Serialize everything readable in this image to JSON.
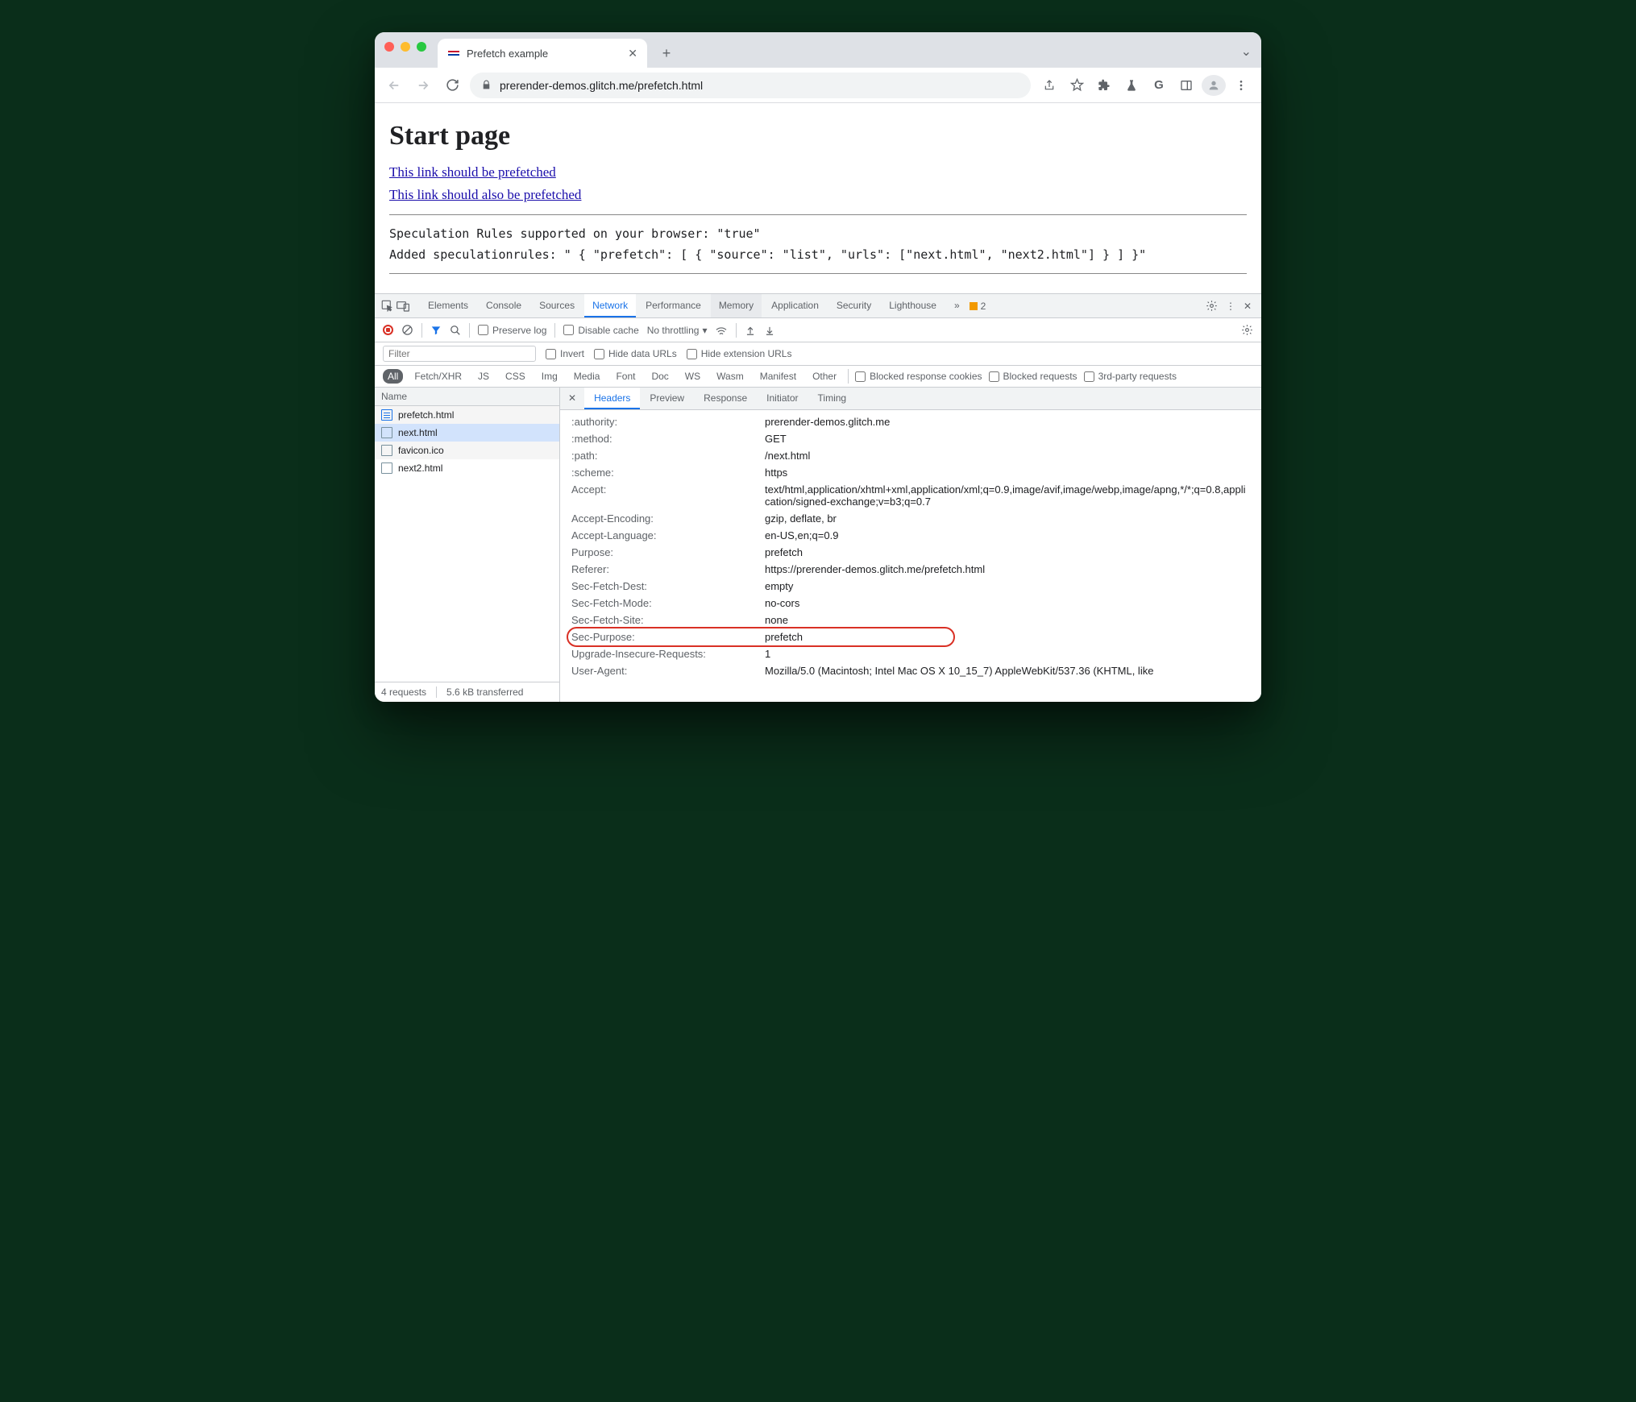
{
  "browser": {
    "tab_title": "Prefetch example",
    "url": "prerender-demos.glitch.me/prefetch.html"
  },
  "page": {
    "heading": "Start page",
    "link1": "This link should be prefetched",
    "link2": "This link should also be prefetched",
    "status1": "Speculation Rules supported on your browser: \"true\"",
    "status2": "Added speculationrules: \" { \"prefetch\": [ { \"source\": \"list\", \"urls\": [\"next.html\", \"next2.html\"] } ] }\""
  },
  "devtools": {
    "panels": {
      "elements": "Elements",
      "console": "Console",
      "sources": "Sources",
      "network": "Network",
      "performance": "Performance",
      "memory": "Memory",
      "application": "Application",
      "security": "Security",
      "lighthouse": "Lighthouse"
    },
    "issues_count": "2",
    "toolbar": {
      "preserve": "Preserve log",
      "disable_cache": "Disable cache",
      "throttling": "No throttling"
    },
    "filter": {
      "placeholder": "Filter",
      "invert": "Invert",
      "hide_data": "Hide data URLs",
      "hide_ext": "Hide extension URLs"
    },
    "types": [
      "All",
      "Fetch/XHR",
      "JS",
      "CSS",
      "Img",
      "Media",
      "Font",
      "Doc",
      "WS",
      "Wasm",
      "Manifest",
      "Other"
    ],
    "type_checks": {
      "blocked_cookies": "Blocked response cookies",
      "blocked_req": "Blocked requests",
      "third_party": "3rd-party requests"
    },
    "requests": {
      "header": "Name",
      "rows": [
        {
          "name": "prefetch.html",
          "type": "doc"
        },
        {
          "name": "next.html",
          "type": "plain",
          "selected": true
        },
        {
          "name": "favicon.ico",
          "type": "plain"
        },
        {
          "name": "next2.html",
          "type": "plain"
        }
      ],
      "footer_count": "4 requests",
      "footer_size": "5.6 kB transferred"
    },
    "detail_tabs": {
      "headers": "Headers",
      "preview": "Preview",
      "response": "Response",
      "initiator": "Initiator",
      "timing": "Timing"
    },
    "headers": [
      {
        "name": ":authority:",
        "value": "prerender-demos.glitch.me"
      },
      {
        "name": ":method:",
        "value": "GET"
      },
      {
        "name": ":path:",
        "value": "/next.html"
      },
      {
        "name": ":scheme:",
        "value": "https"
      },
      {
        "name": "Accept:",
        "value": "text/html,application/xhtml+xml,application/xml;q=0.9,image/avif,image/webp,image/apng,*/*;q=0.8,application/signed-exchange;v=b3;q=0.7"
      },
      {
        "name": "Accept-Encoding:",
        "value": "gzip, deflate, br"
      },
      {
        "name": "Accept-Language:",
        "value": "en-US,en;q=0.9"
      },
      {
        "name": "Purpose:",
        "value": "prefetch"
      },
      {
        "name": "Referer:",
        "value": "https://prerender-demos.glitch.me/prefetch.html"
      },
      {
        "name": "Sec-Fetch-Dest:",
        "value": "empty"
      },
      {
        "name": "Sec-Fetch-Mode:",
        "value": "no-cors"
      },
      {
        "name": "Sec-Fetch-Site:",
        "value": "none"
      },
      {
        "name": "Sec-Purpose:",
        "value": "prefetch",
        "highlight": true
      },
      {
        "name": "Upgrade-Insecure-Requests:",
        "value": "1"
      },
      {
        "name": "User-Agent:",
        "value": "Mozilla/5.0 (Macintosh; Intel Mac OS X 10_15_7) AppleWebKit/537.36 (KHTML, like"
      }
    ]
  }
}
